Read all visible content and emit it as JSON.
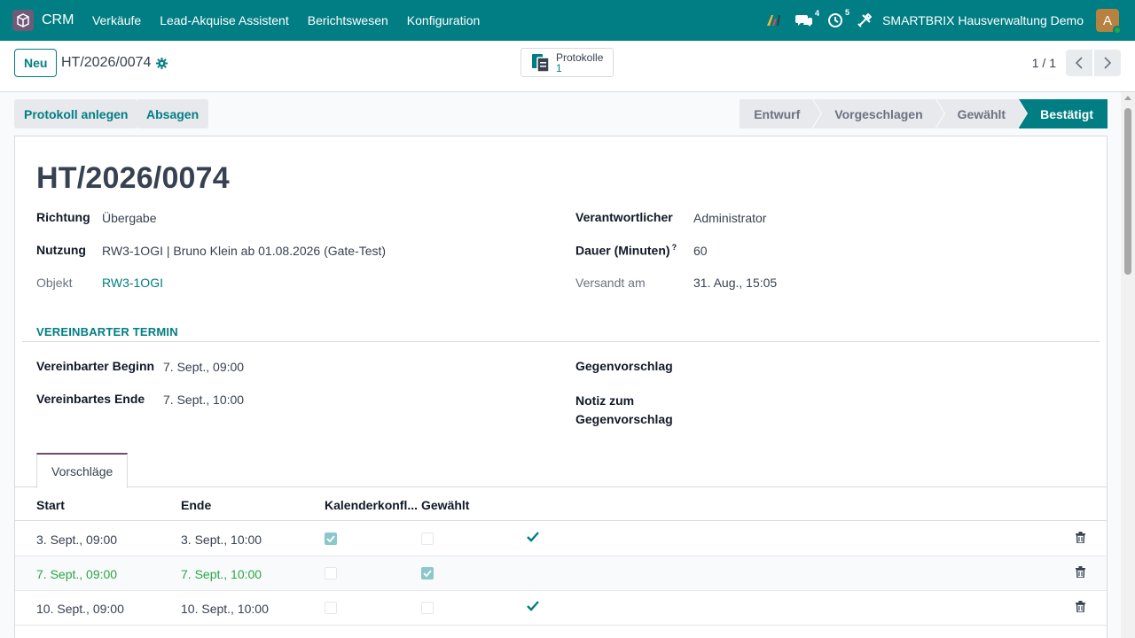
{
  "navbar": {
    "app_name": "CRM",
    "menu": [
      "Verkäufe",
      "Lead-Akquise Assistent",
      "Berichtswesen",
      "Konfiguration"
    ],
    "messages_badge": "4",
    "activities_badge": "5",
    "company": "SMARTBRIX Hausverwaltung Demo",
    "avatar_letter": "A"
  },
  "control": {
    "new_label": "Neu",
    "breadcrumb": "HT/2026/0074",
    "smart_button_label": "Protokolle",
    "smart_button_count": "1",
    "pager": "1 / 1"
  },
  "statusbar": {
    "actions": [
      "Protokoll anlegen",
      "Absagen"
    ],
    "stages": [
      "Entwurf",
      "Vorgeschlagen",
      "Gewählt",
      "Bestätigt"
    ],
    "active_stage": "Bestätigt"
  },
  "record": {
    "title": "HT/2026/0074",
    "richtung_label": "Richtung",
    "richtung": "Übergabe",
    "nutzung_label": "Nutzung",
    "nutzung": "RW3-1OGI | Bruno Klein ab 01.08.2026 (Gate-Test)",
    "objekt_label": "Objekt",
    "objekt": "RW3-1OGI",
    "verantwortlicher_label": "Verantwortlicher",
    "verantwortlicher": "Administrator",
    "dauer_label": "Dauer (Minuten)",
    "dauer_help": "?",
    "dauer": "60",
    "versandt_label": "Versandt am",
    "versandt": "31. Aug., 15:05"
  },
  "termin": {
    "section_title": "VEREINBARTER TERMIN",
    "beginn_label": "Vereinbarter Beginn",
    "beginn": "7. Sept., 09:00",
    "ende_label": "Vereinbartes Ende",
    "ende": "7. Sept., 10:00",
    "gegenvorschlag_label": "Gegenvorschlag",
    "notiz_label_1": "Notiz zum",
    "notiz_label_2": "Gegenvorschlag"
  },
  "tabs": {
    "active": "Vorschläge"
  },
  "table": {
    "headers": [
      "Start",
      "Ende",
      "Kalenderkonfl...",
      "Gewählt"
    ],
    "rows": [
      {
        "start": "3. Sept., 09:00",
        "ende": "3. Sept., 10:00",
        "konflikt": true,
        "gewaehlt": false,
        "check": true
      },
      {
        "start": "7. Sept., 09:00",
        "ende": "7. Sept., 10:00",
        "konflikt": false,
        "gewaehlt": true,
        "check": false
      },
      {
        "start": "10. Sept., 09:00",
        "ende": "10. Sept., 10:00",
        "konflikt": false,
        "gewaehlt": false,
        "check": true
      }
    ]
  },
  "colors": {
    "brand": "#017e84",
    "tab_accent": "#714b67",
    "selected_row": "#28a745"
  }
}
